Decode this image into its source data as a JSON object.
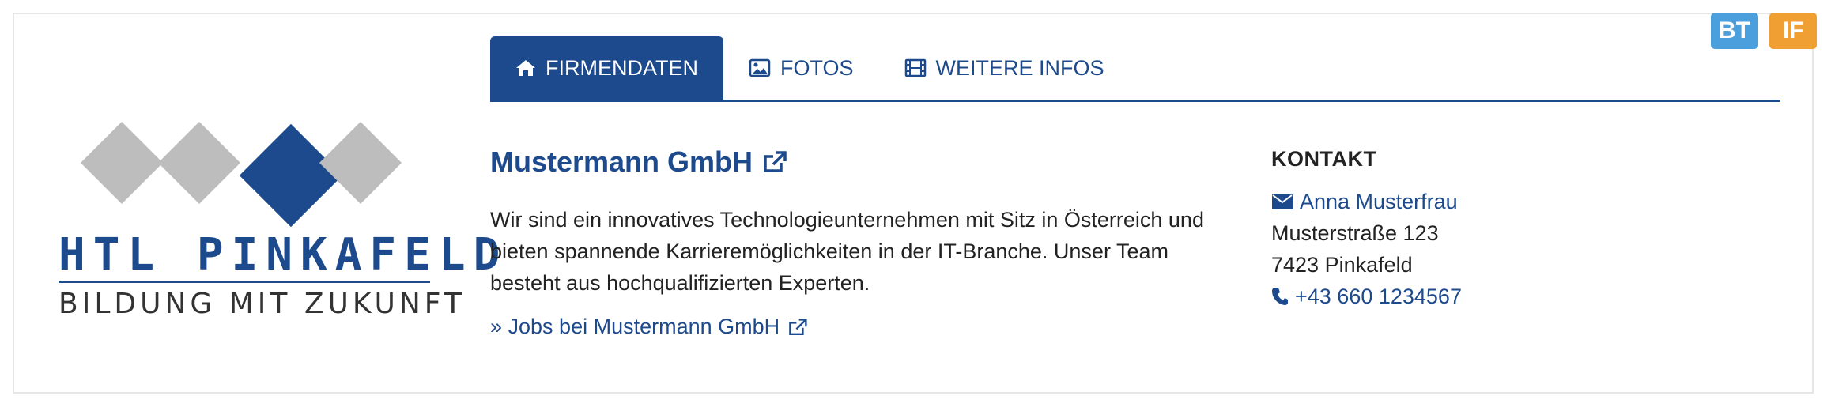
{
  "badges": [
    {
      "label": "BT",
      "color": "#4a9fdc"
    },
    {
      "label": "IF",
      "color": "#f0a032"
    }
  ],
  "logo": {
    "line1": "HTL PINKAFELD",
    "line2": "BILDUNG MIT ZUKUNFT",
    "primary_color": "#1d4a8c",
    "secondary_color": "#bdbdbd"
  },
  "tabs": [
    {
      "label": "FIRMENDATEN",
      "icon": "home-icon",
      "active": true
    },
    {
      "label": "FOTOS",
      "icon": "image-icon",
      "active": false
    },
    {
      "label": "WEITERE INFOS",
      "icon": "film-icon",
      "active": false
    }
  ],
  "company": {
    "name": "Mustermann GmbH",
    "description": "Wir sind ein innovatives Technologieunternehmen mit Sitz in Österreich und bieten spannende Karrieremöglichkeiten in der IT-Branche. Unser Team besteht aus hochqualifizierten Experten.",
    "jobs_link": "» Jobs bei Mustermann GmbH"
  },
  "contact": {
    "heading": "KONTAKT",
    "person": "Anna Musterfrau",
    "street": "Musterstraße 123",
    "city": "7423 Pinkafeld",
    "phone": "+43 660 1234567"
  },
  "colors": {
    "accent": "#1d4a8c",
    "text": "#222222",
    "border": "#e6e6e6"
  }
}
